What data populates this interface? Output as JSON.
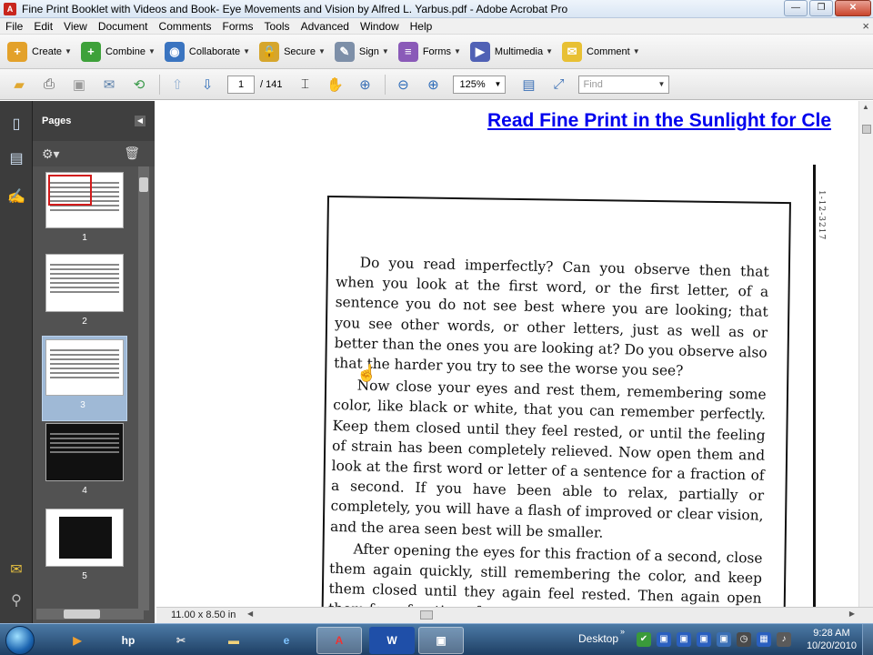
{
  "window": {
    "title": "Fine Print Booklet with Videos and Book- Eye Movements and Vision by Alfred L. Yarbus.pdf - Adobe Acrobat Pro",
    "minimize": "—",
    "restore": "❐",
    "close": "✕"
  },
  "menubar": {
    "items": [
      "File",
      "Edit",
      "View",
      "Document",
      "Comments",
      "Forms",
      "Tools",
      "Advanced",
      "Window",
      "Help"
    ],
    "close_glyph": "×"
  },
  "tasks": {
    "create": "Create",
    "combine": "Combine",
    "collaborate": "Collaborate",
    "secure": "Secure",
    "sign": "Sign",
    "forms": "Forms",
    "multimedia": "Multimedia",
    "comment": "Comment"
  },
  "quick": {
    "page_current": "1",
    "page_total": "/ 141",
    "zoom": "125%",
    "find_placeholder": "Find"
  },
  "pages_panel": {
    "title": "Pages",
    "thumbnails": [
      {
        "num": "1"
      },
      {
        "num": "2"
      },
      {
        "num": "3"
      },
      {
        "num": "4"
      },
      {
        "num": "5"
      }
    ]
  },
  "document": {
    "link_text": "Read Fine Print in the Sunlight for Cle",
    "paragraphs": [
      "Do you read imperfectly? Can you observe then that when you look at the first word, or the first letter, of a sentence you do not see best where you are looking; that you see other words, or other letters, just as well as or better than the ones you are looking at? Do you observe also that the harder you try to see the worse you see?",
      "Now close your eyes and rest them, remembering some color, like black or white, that you can remember perfectly. Keep them closed until they feel rested, or until the feeling of strain has been completely relieved. Now open them and look at the first word or letter of a sentence for a fraction of a second. If you have been able to relax, partially or completely, you will have a flash of improved or clear vision, and the area seen best will be smaller.",
      "After opening the eyes for this fraction of a second, close them again quickly, still remembering the color, and keep them closed until they again feel rested. Then again open them for a fraction of a second."
    ],
    "side_note": "1-12-3217"
  },
  "status": {
    "page_size": "11.00 x 8.50 in"
  },
  "taskbar": {
    "desktop_label": "Desktop",
    "time": "9:28 AM",
    "date": "10/20/2010"
  },
  "colors": {
    "link": "#0000ee",
    "panel_bg": "#525252",
    "selection": "#9fb9d6"
  }
}
